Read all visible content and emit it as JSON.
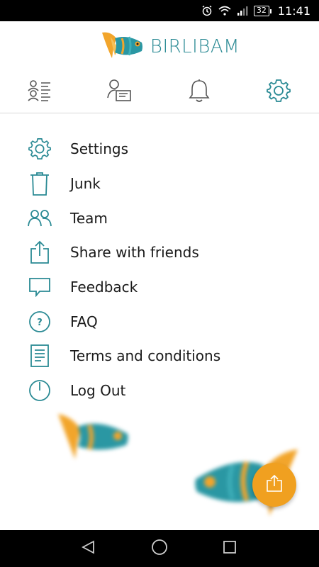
{
  "status_bar": {
    "battery": "32",
    "time": "11:41",
    "icons": [
      "alarm-icon",
      "wifi-icon",
      "signal-icon",
      "battery-icon"
    ]
  },
  "header": {
    "brand_name": "BIRLIBAM",
    "logo": "fish-logo-icon"
  },
  "tabs": [
    {
      "icon": "contact-list-icon",
      "active": false
    },
    {
      "icon": "profile-card-icon",
      "active": false
    },
    {
      "icon": "bell-icon",
      "active": false
    },
    {
      "icon": "gear-icon",
      "active": true
    }
  ],
  "menu": {
    "items": [
      {
        "label": "Settings",
        "icon": "gear-icon"
      },
      {
        "label": "Junk",
        "icon": "trash-icon"
      },
      {
        "label": "Team",
        "icon": "team-icon"
      },
      {
        "label": "Share with friends",
        "icon": "share-icon"
      },
      {
        "label": "Feedback",
        "icon": "speech-bubble-icon"
      },
      {
        "label": "FAQ",
        "icon": "question-icon"
      },
      {
        "label": "Terms and conditions",
        "icon": "document-icon"
      },
      {
        "label": "Log Out",
        "icon": "power-icon"
      }
    ]
  },
  "fab": {
    "icon": "share-icon"
  },
  "nav_bar": {
    "icons": [
      "back-icon",
      "home-icon",
      "recents-icon"
    ]
  },
  "colors": {
    "accent": "#2a8a94",
    "fab": "#f0a020",
    "fish_orange": "#f2a52b",
    "fish_teal": "#2a97a3"
  }
}
